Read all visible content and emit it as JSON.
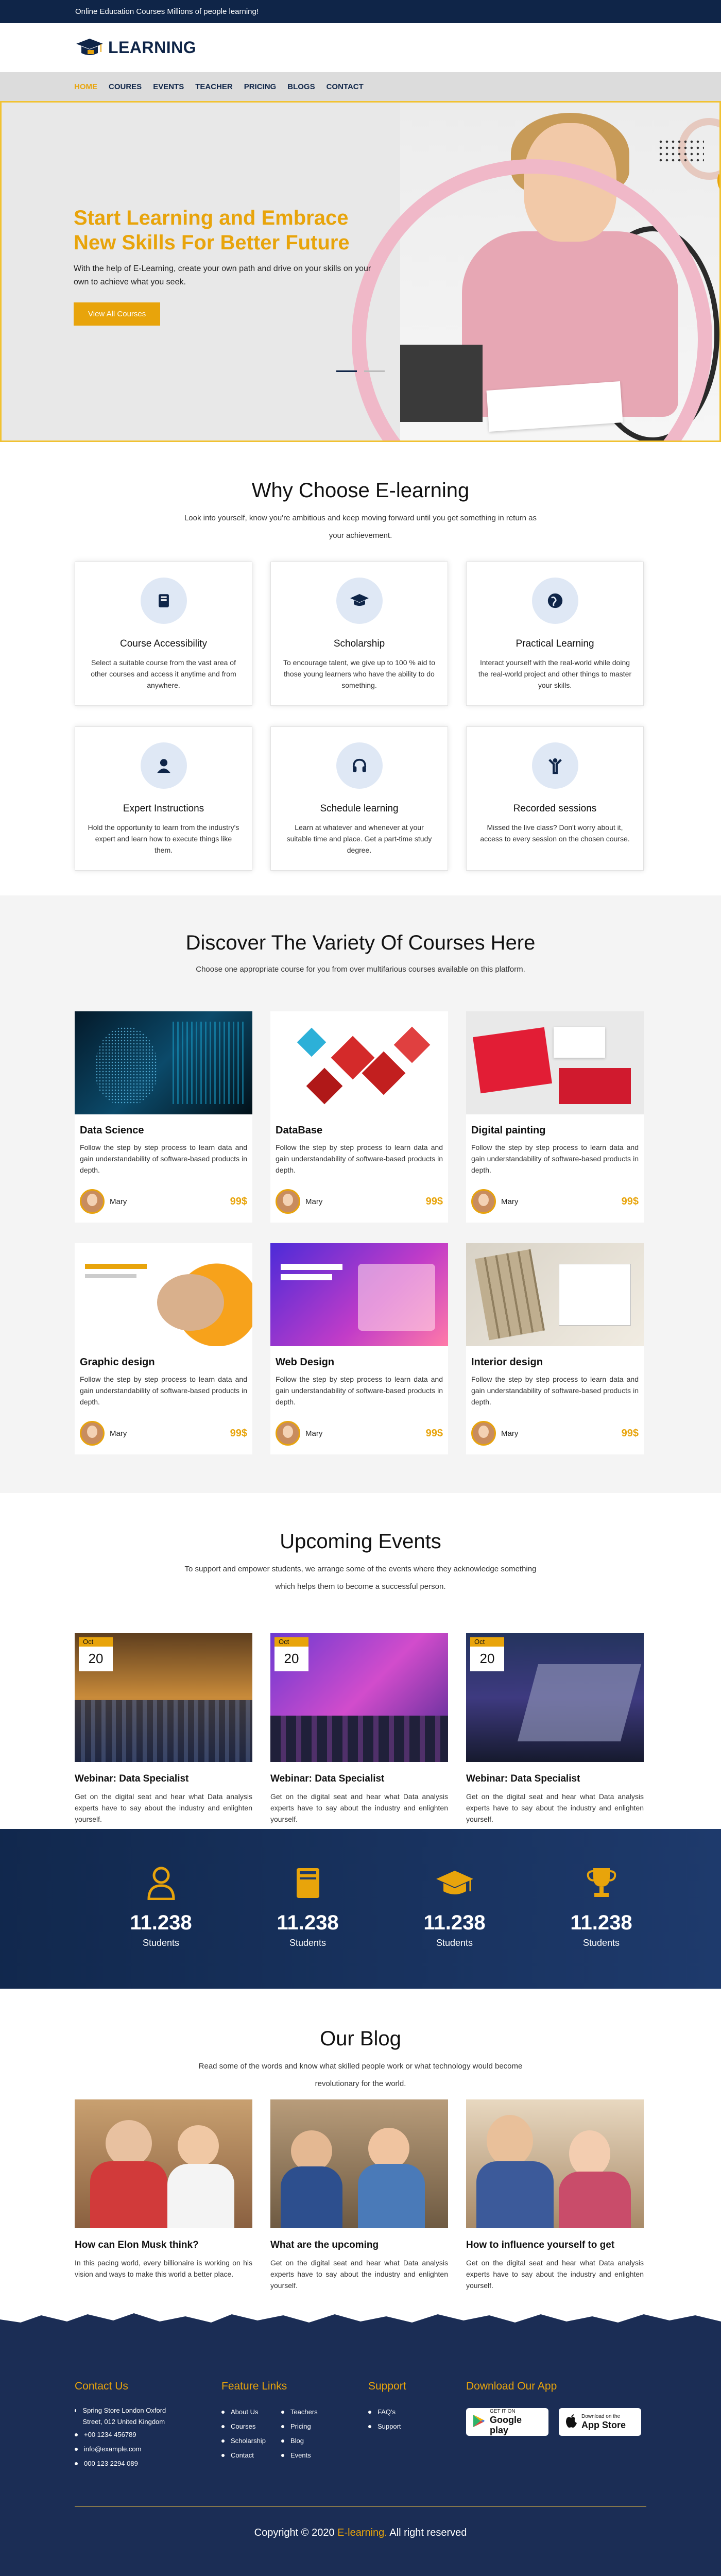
{
  "topbar": {
    "text": "Online Education Courses Millions of people learning!"
  },
  "logo": {
    "text": "LEARNING"
  },
  "nav": [
    "HOME",
    "COURES",
    "EVENTS",
    "TEACHER",
    "PRICING",
    "BLOGS",
    "CONTACT"
  ],
  "hero": {
    "title": "Start Learning and Embrace New Skills For Better Future",
    "text": "With the help of E-Learning, create your own path and drive on your skills on your own to achieve what you seek.",
    "button": "View All Courses"
  },
  "why": {
    "title": "Why Choose E-learning",
    "subtitle": "Look into yourself, know you're ambitious and keep moving forward until you get something in return as your achievement.",
    "cards": [
      {
        "icon": "book-icon",
        "title": "Course Accessibility",
        "text": "Select a suitable course from the vast area of other courses and access it anytime and from anywhere."
      },
      {
        "icon": "graduation-cap-icon",
        "title": "Scholarship",
        "text": "To encourage talent, we give up to 100 % aid to those young learners who have the ability to do something."
      },
      {
        "icon": "globe-icon",
        "title": "Practical Learning",
        "text": "Interact yourself with the real-world while doing the real-world project and other things to master your skills."
      },
      {
        "icon": "user-icon",
        "title": "Expert Instructions",
        "text": "Hold the opportunity to learn from the industry's expert and learn how to execute things like them."
      },
      {
        "icon": "headset-icon",
        "title": "Schedule learning",
        "text": "Learn at whatever and whenever at your suitable time and place. Get a part-time study degree."
      },
      {
        "icon": "person-raised-arms-icon",
        "title": "Recorded sessions",
        "text": "Missed the live class? Don't worry about it, access to every session on the chosen course."
      }
    ]
  },
  "courses": {
    "title": "Discover The Variety Of Courses Here",
    "subtitle": "Choose one appropriate course for you from over multifarious courses available on this platform.",
    "items": [
      {
        "title": "Data Science",
        "text": "Follow the step by step process to learn data and gain understandability of software-based products in depth.",
        "author": "Mary",
        "price": "99$"
      },
      {
        "title": "DataBase",
        "text": "Follow the step by step process to learn data and gain understandability of software-based products in depth.",
        "author": "Mary",
        "price": "99$"
      },
      {
        "title": "Digital painting",
        "text": "Follow the step by step process to learn data and gain understandability of software-based products in depth.",
        "author": "Mary",
        "price": "99$"
      },
      {
        "title": "Graphic design",
        "text": "Follow the step by step process to learn data and gain understandability of software-based products in depth.",
        "author": "Mary",
        "price": "99$"
      },
      {
        "title": "Web Design",
        "text": "Follow the step by step process to learn data and gain understandability of software-based products in depth.",
        "author": "Mary",
        "price": "99$"
      },
      {
        "title": "Interior design",
        "text": "Follow the step by step process to learn data and gain understandability of software-based products in depth.",
        "author": "Mary",
        "price": "99$"
      }
    ]
  },
  "events": {
    "title": "Upcoming Events",
    "subtitle": "To support and empower students, we arrange some of the events where they acknowledge something which helps them to become a successful person.",
    "items": [
      {
        "month": "Oct",
        "day": "20",
        "title": "Webinar: Data Specialist",
        "text": "Get on the digital seat and hear what Data analysis experts have to say about the industry and enlighten yourself."
      },
      {
        "month": "Oct",
        "day": "20",
        "title": "Webinar: Data Specialist",
        "text": "Get on the digital seat and hear what Data analysis experts have to say about the industry and enlighten yourself."
      },
      {
        "month": "Oct",
        "day": "20",
        "title": "Webinar: Data Specialist",
        "text": "Get on the digital seat and hear what Data analysis experts have to say about the industry and enlighten yourself."
      }
    ]
  },
  "stats": [
    {
      "icon": "user-outline-icon",
      "value": "11.238",
      "label": "Students"
    },
    {
      "icon": "book-closed-icon",
      "value": "11.238",
      "label": "Students"
    },
    {
      "icon": "graduation-cap-icon",
      "value": "11.238",
      "label": "Students"
    },
    {
      "icon": "trophy-icon",
      "value": "11.238",
      "label": "Students"
    }
  ],
  "blog": {
    "title": "Our Blog",
    "subtitle": "Read some of the words and know what skilled people work or what technology would become revolutionary for the world.",
    "items": [
      {
        "title": "How can Elon Musk think?",
        "text": "In this pacing world, every billionaire is working on his vision and ways to make this world a better place."
      },
      {
        "title": "What are the upcoming",
        "text": "Get on the digital seat and hear what Data analysis experts have to say about the industry and enlighten yourself."
      },
      {
        "title": "How to influence yourself to get",
        "text": "Get on the digital seat and hear what Data analysis experts have to say about the industry and enlighten yourself."
      }
    ]
  },
  "footer": {
    "contact_title": "Contact Us",
    "contact": [
      "Spring Store London Oxford Street, 012 United Kingdom",
      "+00 1234 456789",
      "info@example.com",
      "000 123 2294 089"
    ],
    "feature_title": "Feature Links",
    "feature_col1": [
      "About Us",
      "Courses",
      "Scholarship",
      "Contact"
    ],
    "feature_col2": [
      "Teachers",
      "Pricing",
      "Blog",
      "Events"
    ],
    "support_title": "Support",
    "support": [
      "FAQ's",
      "Support"
    ],
    "app_title": "Download Our App",
    "google_small": "GET IT ON",
    "google_big": "Google play",
    "apple_small": "Download on the",
    "apple_big": "App Store",
    "copyright_prefix": "Copyright © 2020",
    "copyright_brand": "E-learning.",
    "copyright_suffix": "All right reserved"
  },
  "colors": {
    "navy": "#0f2548",
    "accent": "#e8a40b",
    "pink": "#f0b8c8"
  }
}
